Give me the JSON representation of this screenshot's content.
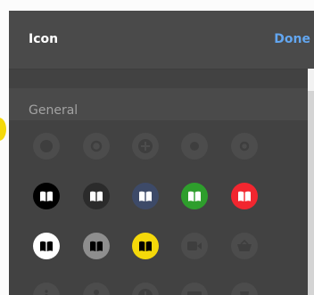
{
  "header": {
    "title": "Icon",
    "done_label": "Done"
  },
  "section": {
    "title": "General"
  },
  "icon_rows": [
    [
      {
        "name": "dot-icon",
        "glyph": "dot",
        "bg": "#4c4c4c",
        "fg": "#3e3e3e"
      },
      {
        "name": "ring-icon",
        "glyph": "ring",
        "bg": "#4c4c4c",
        "fg": "#3e3e3e"
      },
      {
        "name": "plus-icon",
        "glyph": "plus",
        "bg": "#4c4c4c",
        "fg": "#3e3e3e"
      },
      {
        "name": "dot-icon",
        "glyph": "small-dot",
        "bg": "#4c4c4c",
        "fg": "#3e3e3e"
      },
      {
        "name": "ring-icon",
        "glyph": "small-ring",
        "bg": "#4c4c4c",
        "fg": "#3e3e3e"
      }
    ],
    [
      {
        "name": "book-icon",
        "glyph": "book",
        "bg": "#000000",
        "fg": "#ffffff"
      },
      {
        "name": "book-icon",
        "glyph": "book",
        "bg": "#2b2b2b",
        "fg": "#ffffff"
      },
      {
        "name": "book-icon",
        "glyph": "book",
        "bg": "#3d4a68",
        "fg": "#ffffff"
      },
      {
        "name": "book-icon",
        "glyph": "book",
        "bg": "#2e9e2c",
        "fg": "#ffffff"
      },
      {
        "name": "book-icon",
        "glyph": "book",
        "bg": "#f2262f",
        "fg": "#ffffff"
      }
    ],
    [
      {
        "name": "book-icon",
        "glyph": "book",
        "bg": "#ffffff",
        "fg": "#000000"
      },
      {
        "name": "book-icon",
        "glyph": "book",
        "bg": "#8e8e8e",
        "fg": "#000000"
      },
      {
        "name": "book-icon",
        "glyph": "book",
        "bg": "#f5d90a",
        "fg": "#000000"
      },
      {
        "name": "video-icon",
        "glyph": "video",
        "bg": "#4c4c4c",
        "fg": "#3e3e3e"
      },
      {
        "name": "basket-icon",
        "glyph": "basket",
        "bg": "#4c4c4c",
        "fg": "#3e3e3e"
      }
    ],
    [
      {
        "name": "info-icon",
        "glyph": "info",
        "bg": "#4c4c4c",
        "fg": "#3e3e3e"
      },
      {
        "name": "person-icon",
        "glyph": "person",
        "bg": "#4c4c4c",
        "fg": "#3e3e3e"
      },
      {
        "name": "plus-icon",
        "glyph": "plus",
        "bg": "#4c4c4c",
        "fg": "#3e3e3e"
      },
      {
        "name": "card-icon",
        "glyph": "card",
        "bg": "#4c4c4c",
        "fg": "#3e3e3e"
      },
      {
        "name": "cup-icon",
        "glyph": "cup",
        "bg": "#4c4c4c",
        "fg": "#3e3e3e"
      }
    ]
  ]
}
